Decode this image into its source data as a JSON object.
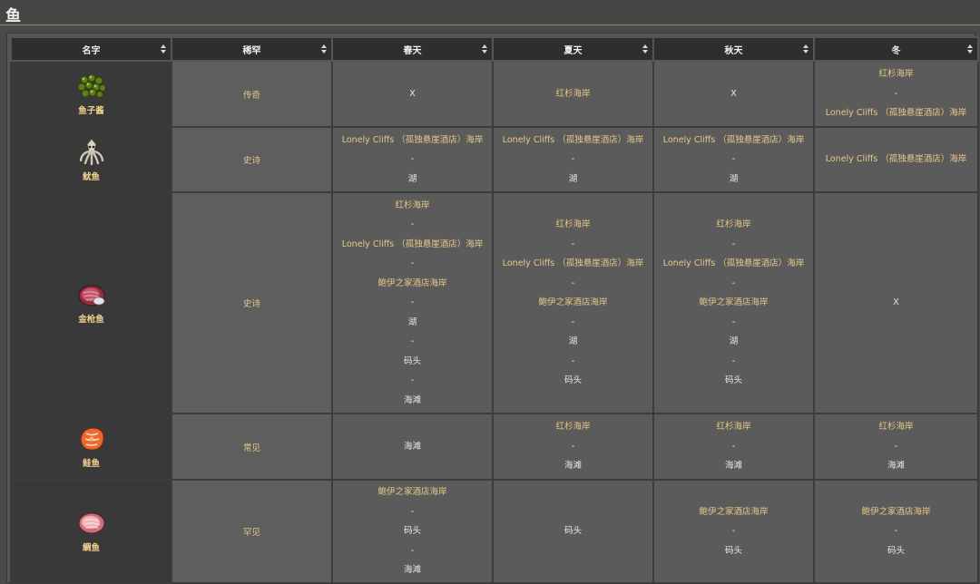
{
  "page": {
    "title": "鱼"
  },
  "table": {
    "headers": [
      "名字",
      "稀罕",
      "春天",
      "夏天",
      "秋天",
      "冬"
    ],
    "rows": [
      {
        "name": "鱼子酱",
        "icon": "caviar-icon",
        "rarity": "传奇",
        "cells": [
          [
            {
              "t": "X",
              "c": "plain"
            }
          ],
          [
            {
              "t": "红杉海岸",
              "c": "gold"
            }
          ],
          [
            {
              "t": "X",
              "c": "plain"
            }
          ],
          [
            {
              "t": "红杉海岸",
              "c": "gold"
            },
            {
              "t": "-",
              "c": "plain"
            },
            {
              "t": "Lonely Cliffs （孤独悬崖酒店）海岸",
              "c": "gold"
            }
          ]
        ]
      },
      {
        "name": "鱿鱼",
        "icon": "squid-icon",
        "rarity": "史诗",
        "cells": [
          [
            {
              "t": "Lonely Cliffs （孤独悬崖酒店）海岸",
              "c": "gold"
            },
            {
              "t": "-",
              "c": "plain"
            },
            {
              "t": "湖",
              "c": "plain"
            }
          ],
          [
            {
              "t": "Lonely Cliffs （孤独悬崖酒店）海岸",
              "c": "gold"
            },
            {
              "t": "-",
              "c": "plain"
            },
            {
              "t": "湖",
              "c": "plain"
            }
          ],
          [
            {
              "t": "Lonely Cliffs （孤独悬崖酒店）海岸",
              "c": "gold"
            },
            {
              "t": "-",
              "c": "plain"
            },
            {
              "t": "湖",
              "c": "plain"
            }
          ],
          [
            {
              "t": "Lonely Cliffs （孤独悬崖酒店）海岸",
              "c": "gold"
            }
          ]
        ]
      },
      {
        "name": "金枪鱼",
        "icon": "tuna-icon",
        "rarity": "史诗",
        "cells": [
          [
            {
              "t": "红杉海岸",
              "c": "gold"
            },
            {
              "t": "-",
              "c": "plain"
            },
            {
              "t": "Lonely Cliffs （孤独悬崖酒店）海岸",
              "c": "gold"
            },
            {
              "t": "-",
              "c": "plain"
            },
            {
              "t": "鲍伊之家酒店海岸",
              "c": "gold"
            },
            {
              "t": "-",
              "c": "plain"
            },
            {
              "t": "湖",
              "c": "plain"
            },
            {
              "t": "-",
              "c": "plain"
            },
            {
              "t": "码头",
              "c": "plain"
            },
            {
              "t": "-",
              "c": "plain"
            },
            {
              "t": "海滩",
              "c": "plain"
            }
          ],
          [
            {
              "t": "红杉海岸",
              "c": "gold"
            },
            {
              "t": "-",
              "c": "plain"
            },
            {
              "t": "Lonely Cliffs （孤独悬崖酒店）海岸",
              "c": "gold"
            },
            {
              "t": "-",
              "c": "plain"
            },
            {
              "t": "鲍伊之家酒店海岸",
              "c": "gold"
            },
            {
              "t": "-",
              "c": "plain"
            },
            {
              "t": "湖",
              "c": "plain"
            },
            {
              "t": "-",
              "c": "plain"
            },
            {
              "t": "码头",
              "c": "plain"
            }
          ],
          [
            {
              "t": "红杉海岸",
              "c": "gold"
            },
            {
              "t": "-",
              "c": "plain"
            },
            {
              "t": "Lonely Cliffs （孤独悬崖酒店）海岸",
              "c": "gold"
            },
            {
              "t": "-",
              "c": "plain"
            },
            {
              "t": "鲍伊之家酒店海岸",
              "c": "gold"
            },
            {
              "t": "-",
              "c": "plain"
            },
            {
              "t": "湖",
              "c": "plain"
            },
            {
              "t": "-",
              "c": "plain"
            },
            {
              "t": "码头",
              "c": "plain"
            }
          ],
          [
            {
              "t": "X",
              "c": "plain"
            }
          ]
        ]
      },
      {
        "name": "鲑鱼",
        "icon": "salmon-icon",
        "rarity": "常见",
        "cells": [
          [
            {
              "t": "海滩",
              "c": "plain"
            }
          ],
          [
            {
              "t": "红杉海岸",
              "c": "gold"
            },
            {
              "t": "-",
              "c": "plain"
            },
            {
              "t": "海滩",
              "c": "plain"
            }
          ],
          [
            {
              "t": "红杉海岸",
              "c": "gold"
            },
            {
              "t": "-",
              "c": "plain"
            },
            {
              "t": "海滩",
              "c": "plain"
            }
          ],
          [
            {
              "t": "红杉海岸",
              "c": "gold"
            },
            {
              "t": "-",
              "c": "plain"
            },
            {
              "t": "海滩",
              "c": "plain"
            }
          ]
        ]
      },
      {
        "name": "鲷鱼",
        "icon": "snapper-icon",
        "rarity": "罕见",
        "cells": [
          [
            {
              "t": "鲍伊之家酒店海岸",
              "c": "gold"
            },
            {
              "t": "-",
              "c": "plain"
            },
            {
              "t": "码头",
              "c": "plain"
            },
            {
              "t": "-",
              "c": "plain"
            },
            {
              "t": "海滩",
              "c": "plain"
            }
          ],
          [
            {
              "t": "码头",
              "c": "plain"
            }
          ],
          [
            {
              "t": "鲍伊之家酒店海岸",
              "c": "gold"
            },
            {
              "t": "-",
              "c": "plain"
            },
            {
              "t": "码头",
              "c": "plain"
            }
          ],
          [
            {
              "t": "鲍伊之家酒店海岸",
              "c": "gold"
            },
            {
              "t": "-",
              "c": "plain"
            },
            {
              "t": "码头",
              "c": "plain"
            }
          ]
        ]
      }
    ]
  }
}
